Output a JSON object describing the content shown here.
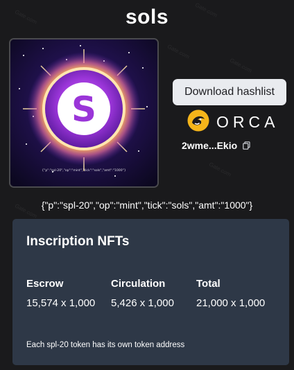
{
  "page": {
    "title": "sols"
  },
  "nft": {
    "center_symbol": "S",
    "inscription_caption": "{\"p\":\"spl-20\",\"op\":\"mint\",\"tick\":\"sols\",\"amt\":\"1000\"}"
  },
  "actions": {
    "download_label": "Download hashlist"
  },
  "marketplace": {
    "name": "ORCA",
    "logo_icon": "orca-logo-icon"
  },
  "address": {
    "short": "2wme...Ekio",
    "copy_icon": "copy-icon"
  },
  "inscription_json": "{\"p\":\"spl-20\",\"op\":\"mint\",\"tick\":\"sols\",\"amt\":\"1000\"}",
  "card": {
    "title": "Inscription NFTs",
    "stats": [
      {
        "label": "Escrow",
        "value": "15,574 x 1,000"
      },
      {
        "label": "Circulation",
        "value": "5,426 x 1,000"
      },
      {
        "label": "Total",
        "value": "21,000 x 1,000"
      }
    ],
    "note": "Each spl-20 token has its own token address"
  },
  "watermark": "Gate.com",
  "colors": {
    "background": "#1a1a1c",
    "card": "#2e3847",
    "button_bg": "#e9ebef",
    "orca_yellow": "#f5b51a",
    "nft_purple": "#8a3bd1",
    "nft_glow": "#ff9a4a"
  }
}
